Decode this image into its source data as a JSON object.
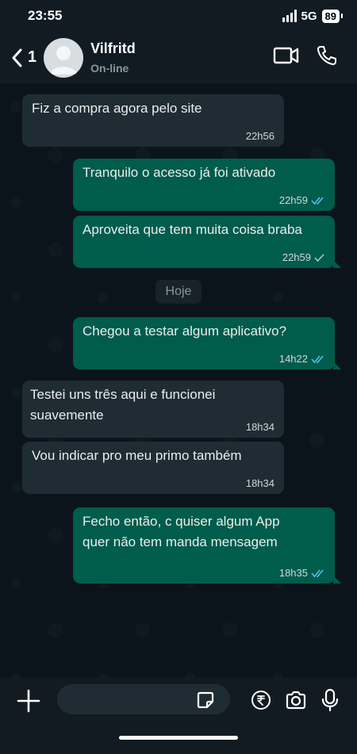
{
  "status_bar": {
    "time": "23:55",
    "network": "5G",
    "battery": "89"
  },
  "header": {
    "unread_count": "1",
    "contact_name": "Vilfritd",
    "contact_status": "On-line"
  },
  "messages": [
    {
      "direction": "in",
      "text": "Fiz a compra agora pelo site",
      "time": "22h56"
    },
    {
      "direction": "out",
      "text": "Tranquilo o acesso já foi ativado",
      "time": "22h59",
      "status": "read"
    },
    {
      "direction": "out",
      "text": "Aproveita que tem muita coisa braba",
      "time": "22h59",
      "status": "sent"
    },
    {
      "direction": "out",
      "text": "Chegou a testar algum aplicativo?",
      "time": "14h22",
      "status": "read"
    },
    {
      "direction": "in",
      "text": "Testei uns três aqui e funcionei suavemente",
      "time": "18h34"
    },
    {
      "direction": "in",
      "text": "Vou indicar pro meu primo também",
      "time": "18h34"
    },
    {
      "direction": "out",
      "text": "Fecho então, c quiser algum App quer não tem manda mensagem",
      "time": "18h35",
      "status": "read"
    }
  ],
  "date_divider": "Hoje",
  "composer": {
    "placeholder": ""
  },
  "colors": {
    "incoming_bubble": "#202c33",
    "outgoing_bubble": "#005c4b",
    "read_ticks": "#53bdeb",
    "background": "#0b141a"
  }
}
